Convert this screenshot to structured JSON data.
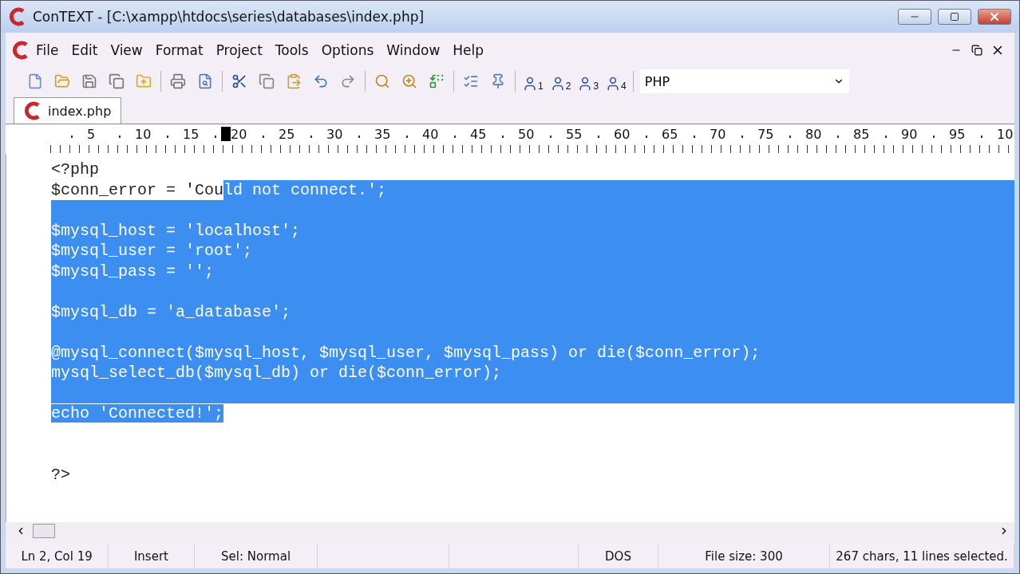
{
  "window": {
    "title": "ConTEXT - [C:\\xampp\\htdocs\\series\\databases\\index.php]"
  },
  "menu": [
    "File",
    "Edit",
    "View",
    "Format",
    "Project",
    "Tools",
    "Options",
    "Window",
    "Help"
  ],
  "toolbar": {
    "user_tools": [
      "1",
      "2",
      "3",
      "4"
    ],
    "highlighter": "PHP"
  },
  "tabs": [
    {
      "label": "index.php",
      "selected": true
    }
  ],
  "ruler": {
    "labels": [
      {
        "label": "5",
        "caret_before": false
      },
      {
        "label": "10",
        "caret_before": false
      },
      {
        "label": "15",
        "caret_before": false
      },
      {
        "label": "20",
        "caret_before": true
      },
      {
        "label": "25",
        "caret_before": false
      },
      {
        "label": "30",
        "caret_before": false
      },
      {
        "label": "35",
        "caret_before": false
      },
      {
        "label": "40",
        "caret_before": false
      },
      {
        "label": "45",
        "caret_before": false
      },
      {
        "label": "50",
        "caret_before": false
      },
      {
        "label": "55",
        "caret_before": false
      },
      {
        "label": "60",
        "caret_before": false
      },
      {
        "label": "65",
        "caret_before": false
      },
      {
        "label": "70",
        "caret_before": false
      },
      {
        "label": "75",
        "caret_before": false
      },
      {
        "label": "80",
        "caret_before": false
      },
      {
        "label": "85",
        "caret_before": false
      },
      {
        "label": "90",
        "caret_before": false
      },
      {
        "label": "95",
        "caret_before": false
      },
      {
        "label": "10",
        "caret_before": false
      }
    ]
  },
  "code": [
    {
      "plain": "<?php",
      "row_selected": false
    },
    {
      "plain": "$conn_error = 'Cou",
      "selected": "ld not connect.';",
      "row_selected": true
    },
    {
      "row_selected": true
    },
    {
      "selected": "$mysql_host = 'localhost';",
      "row_selected": true
    },
    {
      "selected": "$mysql_user = 'root';",
      "row_selected": true
    },
    {
      "selected": "$mysql_pass = '';",
      "row_selected": true
    },
    {
      "row_selected": true
    },
    {
      "selected": "$mysql_db = 'a_database';",
      "row_selected": true
    },
    {
      "row_selected": true
    },
    {
      "selected": "@mysql_connect($mysql_host, $mysql_user, $mysql_pass) or die($conn_error);",
      "row_selected": true
    },
    {
      "selected": "mysql_select_db($mysql_db) or die($conn_error);",
      "row_selected": true
    },
    {
      "row_selected": true
    },
    {
      "selected": "echo 'Connected!';",
      "row_selected": false
    },
    {
      "row_selected": false
    },
    {
      "row_selected": false
    },
    {
      "plain": "?>",
      "row_selected": false
    }
  ],
  "status_bar": [
    "Ln 2, Col 19",
    "Insert",
    "Sel: Normal",
    "DOS",
    "File size: 300",
    "267 chars, 11 lines selected."
  ]
}
